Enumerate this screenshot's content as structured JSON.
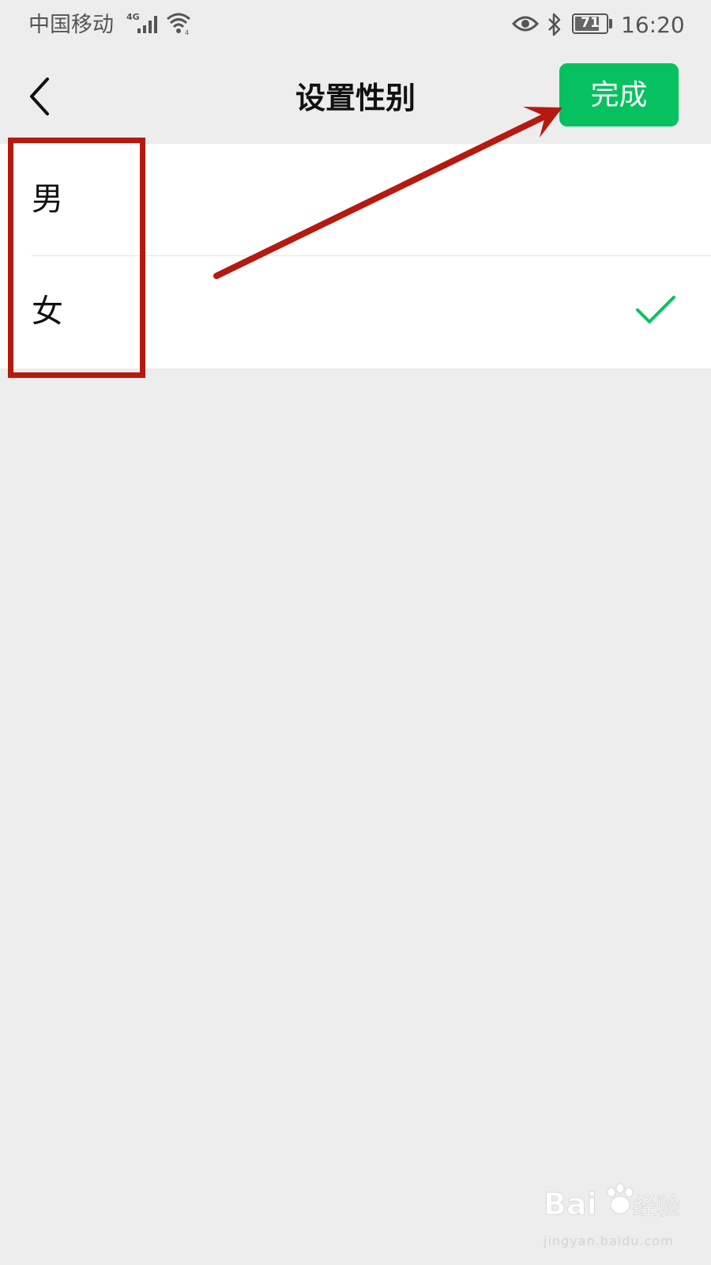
{
  "status_bar": {
    "carrier": "中国移动",
    "network": "4G",
    "battery_level": "71",
    "time": "16:20",
    "icons": [
      "signal-icon",
      "wifi-icon",
      "eye-icon",
      "bluetooth-icon",
      "battery-icon"
    ]
  },
  "nav": {
    "back_icon": "chevron-left-icon",
    "title": "设置性别",
    "done_label": "完成"
  },
  "options": [
    {
      "label": "男",
      "selected": false
    },
    {
      "label": "女",
      "selected": true
    }
  ],
  "colors": {
    "accent": "#07c160",
    "annotation": "#b5190f",
    "background": "#ededed"
  },
  "watermark": {
    "logo_text": "Baidu经验",
    "url": "jingyan.baidu.com"
  }
}
